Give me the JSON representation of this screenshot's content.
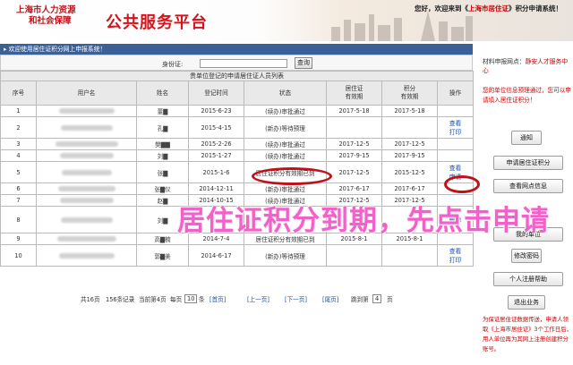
{
  "header": {
    "bureau_line1": "上海市人力资源",
    "bureau_line2": "和社会保障",
    "platform": "公共服务平台",
    "welcome_prefix": "您好，欢迎来到《",
    "welcome_highlight": "上海市居住证",
    "welcome_suffix": "》积分申请系统！"
  },
  "infobar": {
    "text": "欢迎使用居住证积分网上申报系统！"
  },
  "search": {
    "label": "身份证:",
    "value": "",
    "button": "查询"
  },
  "table": {
    "caption": "贵单位登记的申请居住证人员列表",
    "headers": [
      "序号",
      "用户名",
      "姓名",
      "登记时间",
      "状态",
      "居住证\n有效期",
      "积分\n有效期",
      "操作"
    ],
    "rows": [
      {
        "no": "1",
        "name": "董▇",
        "date": "2015-6-23",
        "status": "(续办)审批通过",
        "permit": "2017-5-18",
        "points": "2017-5-18",
        "ops": []
      },
      {
        "no": "2",
        "name": "孔▇",
        "date": "2015-4-15",
        "status": "(新办)等待预理",
        "permit": "",
        "points": "",
        "ops": [
          "查看",
          "打印"
        ]
      },
      {
        "no": "3",
        "name": "樊▇▇",
        "date": "2015-2-26",
        "status": "(续办)审批通过",
        "permit": "2017-12-5",
        "points": "2017-12-5",
        "ops": []
      },
      {
        "no": "4",
        "name": "刘▇",
        "date": "2015-1-27",
        "status": "(续办)审批通过",
        "permit": "2017-9-15",
        "points": "2017-9-15",
        "ops": []
      },
      {
        "no": "5",
        "name": "张▇",
        "date": "2015-1-6",
        "status": "居住证积分有效期已到",
        "permit": "2017-12-5",
        "points": "2015-12-5",
        "ops": [
          "查看",
          "申请"
        ]
      },
      {
        "no": "6",
        "name": "张▇仪",
        "date": "2014-12-11",
        "status": "(新办)审批通过",
        "permit": "2017-6-17",
        "points": "2017-6-17",
        "ops": []
      },
      {
        "no": "7",
        "name": "赵▇",
        "date": "2014-10-15",
        "status": "(续办)审批通过",
        "permit": "2017-12-5",
        "points": "2017-12-5",
        "ops": []
      },
      {
        "no": "8",
        "name": "刘▇",
        "date": "",
        "status": "",
        "permit": "",
        "points": "",
        "ops": [
          "删除"
        ]
      },
      {
        "no": "9",
        "name": "高▇楠",
        "date": "2014-7-4",
        "status": "居住证积分有效期已到",
        "permit": "2015-8-1",
        "points": "2015-8-1",
        "ops": []
      },
      {
        "no": "10",
        "name": "郭▇美",
        "date": "2014-6-17",
        "status": "(新办)等待预理",
        "permit": "",
        "points": "",
        "ops": [
          "查看",
          "打印"
        ]
      }
    ]
  },
  "pager": {
    "total": "共16页",
    "records": "156条记录",
    "current": "当前第4页",
    "per_page_label": "每页",
    "per_page_value": "10",
    "per_page_unit": "条",
    "first": "[首页]",
    "prev": "[上一页]",
    "next": "[下一页]",
    "last": "[尾页]",
    "jump_label": "跳到第",
    "jump_value": "4",
    "jump_unit": "页"
  },
  "sidebar": {
    "title_prefix": "材料申报网点：",
    "title_highlight": "静安人才服务中心",
    "note": "您的单位信息预理通过，您可以申请填入居住证积分！",
    "buttons": [
      "通知",
      "申请居住证积分",
      "查看网点信息",
      "我的单位",
      "修改密码",
      "个人注册帮助",
      "退出业务"
    ],
    "footer": "为保证居住证数据传送，申请人领取《上海市居住证》3个工作日后，用人单位再为其网上注册创建积分账号。"
  },
  "overlay": {
    "text": "居住证积分到期，先点击申请"
  }
}
